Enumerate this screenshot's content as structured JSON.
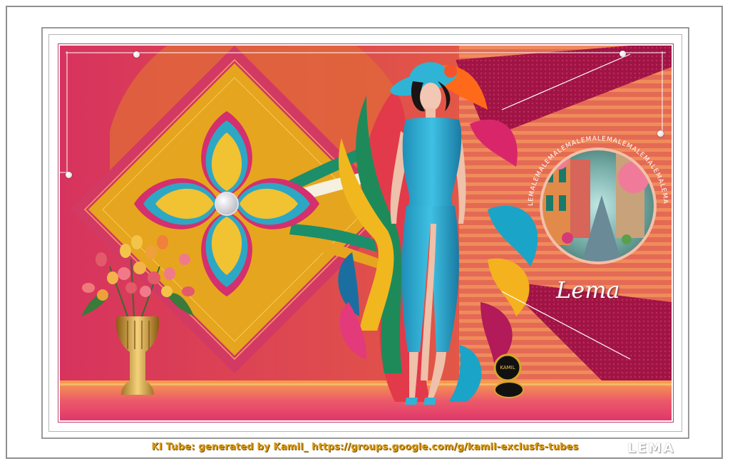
{
  "artwork": {
    "signature": "Lema",
    "circle_text": "LEMALEMALEMALEMALEMALEMALEMALEMALEMALEMA",
    "badge_text": "KAMIL"
  },
  "footer": {
    "credit": "KI Tube: generated by Kamil_ https://groups.google.com/g/kamil-exclusfs-tubes",
    "watermark": "LEMA"
  }
}
